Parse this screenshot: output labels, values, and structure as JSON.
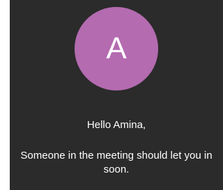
{
  "avatar": {
    "initial": "A",
    "color": "#b46bb0"
  },
  "greeting": "Hello Amina,",
  "message": "Someone in the meeting should let you in soon.",
  "colors": {
    "background": "#2b2b2b",
    "text": "#ffffff"
  }
}
